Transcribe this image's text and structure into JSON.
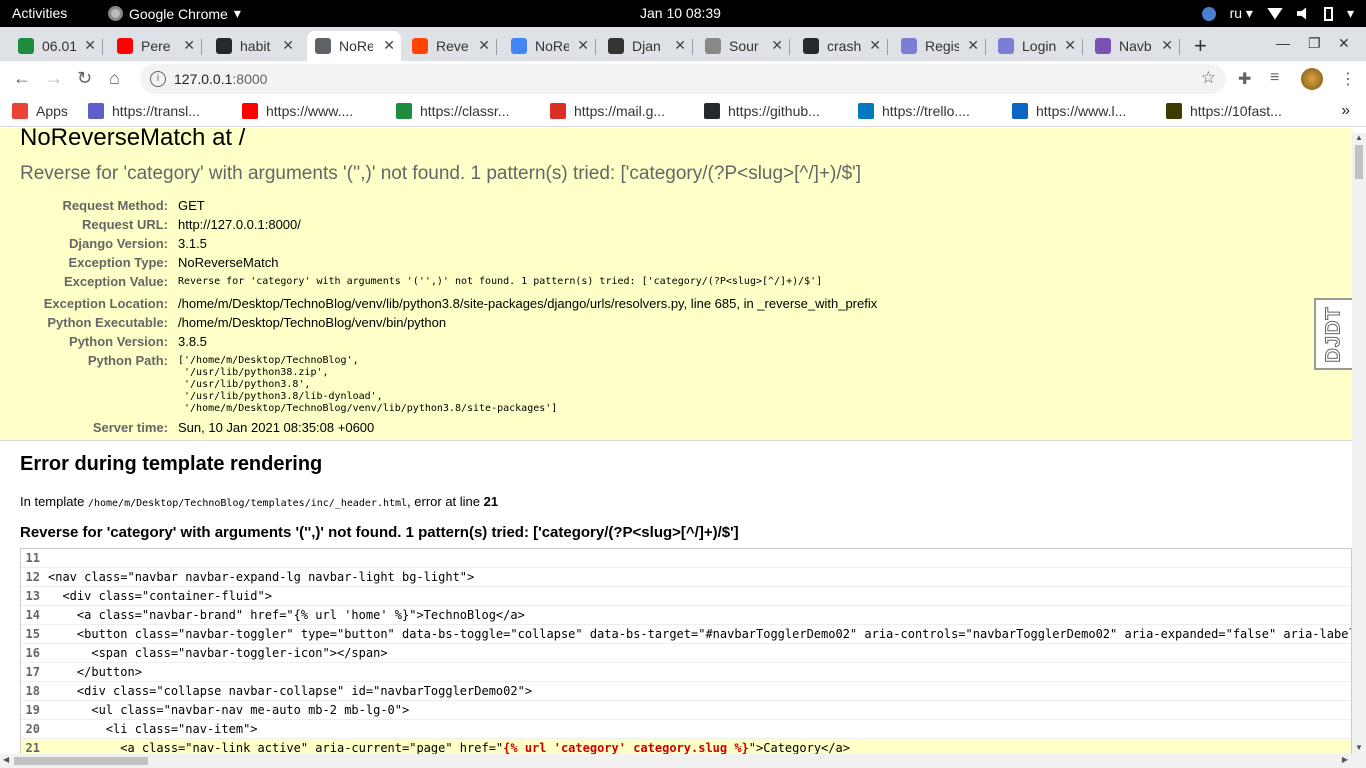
{
  "os": {
    "activities": "Activities",
    "app_name": "Google Chrome",
    "clock": "Jan 10  08:39",
    "language": "ru"
  },
  "tabs": [
    {
      "title": "06.01",
      "color": "#1e8e3e"
    },
    {
      "title": "Pere",
      "color": "#ff0000"
    },
    {
      "title": "habit",
      "color": "#24292e"
    },
    {
      "title": "NoRe",
      "color": "#5f6368"
    },
    {
      "title": "Reve",
      "color": "#ff4500"
    },
    {
      "title": "NoRe",
      "color": "#4285f4"
    },
    {
      "title": "Djan",
      "color": "#333333"
    },
    {
      "title": "Sour",
      "color": "#888888"
    },
    {
      "title": "crash",
      "color": "#24292e"
    },
    {
      "title": "Regis",
      "color": "#7b7fd4"
    },
    {
      "title": "Login",
      "color": "#7b7fd4"
    },
    {
      "title": "Navb",
      "color": "#7952b3"
    }
  ],
  "address": {
    "host": "127.0.0.1",
    "port": ":8000"
  },
  "bookmarks": [
    {
      "label": "Apps",
      "color": "#ea4335"
    },
    {
      "label": "https://transl...",
      "color": "#5b5fc7"
    },
    {
      "label": "https://www....",
      "color": "#ff0000"
    },
    {
      "label": "https://classr...",
      "color": "#1e8e3e"
    },
    {
      "label": "https://mail.g...",
      "color": "#d93025"
    },
    {
      "label": "https://github...",
      "color": "#24292e"
    },
    {
      "label": "https://trello....",
      "color": "#0079bf"
    },
    {
      "label": "https://www.l...",
      "color": "#0a66c2"
    },
    {
      "label": "https://10fast...",
      "color": "#3c3c00"
    }
  ],
  "error": {
    "title": "NoReverseMatch at /",
    "message": "Reverse for 'category' with arguments '('',)' not found. 1 pattern(s) tried: ['category/(?P<slug>[^/]+)/$']",
    "meta": [
      {
        "key": "Request Method:",
        "value": "GET"
      },
      {
        "key": "Request URL:",
        "value": "http://127.0.0.1:8000/"
      },
      {
        "key": "Django Version:",
        "value": "3.1.5"
      },
      {
        "key": "Exception Type:",
        "value": "NoReverseMatch"
      },
      {
        "key": "Exception Value:",
        "value": "Reverse for 'category' with arguments '('',)' not found. 1 pattern(s) tried: ['category/(?P<slug>[^/]+)/$']",
        "mono": true
      },
      {
        "key": "Exception Location:",
        "value": "/home/m/Desktop/TechnoBlog/venv/lib/python3.8/site-packages/django/urls/resolvers.py, line 685, in _reverse_with_prefix"
      },
      {
        "key": "Python Executable:",
        "value": "/home/m/Desktop/TechnoBlog/venv/bin/python"
      },
      {
        "key": "Python Version:",
        "value": "3.8.5"
      },
      {
        "key": "Python Path:",
        "value": "['/home/m/Desktop/TechnoBlog',\n '/usr/lib/python38.zip',\n '/usr/lib/python3.8',\n '/usr/lib/python3.8/lib-dynload',\n '/home/m/Desktop/TechnoBlog/venv/lib/python3.8/site-packages']",
        "mono": true
      },
      {
        "key": "Server time:",
        "value": "Sun, 10 Jan 2021 08:35:08 +0600"
      }
    ],
    "djdt": "DJDT"
  },
  "template": {
    "heading": "Error during template rendering",
    "in_template": "In template",
    "path": "/home/m/Desktop/TechnoBlog/templates/inc/_header.html",
    "error_at": ", error at line",
    "line": "21",
    "message": "Reverse for 'category' with arguments '('',)' not found. 1 pattern(s) tried: ['category/(?P<slug>[^/]+)/$']",
    "source": [
      {
        "n": "11",
        "code": ""
      },
      {
        "n": "12",
        "code": "<nav class=\"navbar navbar-expand-lg navbar-light bg-light\">"
      },
      {
        "n": "13",
        "code": "  <div class=\"container-fluid\">"
      },
      {
        "n": "14",
        "code": "    <a class=\"navbar-brand\" href=\"{% url 'home' %}\">TechnoBlog</a>"
      },
      {
        "n": "15",
        "code": "    <button class=\"navbar-toggler\" type=\"button\" data-bs-toggle=\"collapse\" data-bs-target=\"#navbarTogglerDemo02\" aria-controls=\"navbarTogglerDemo02\" aria-expanded=\"false\" aria-label"
      },
      {
        "n": "16",
        "code": "      <span class=\"navbar-toggler-icon\"></span>"
      },
      {
        "n": "17",
        "code": "    </button>"
      },
      {
        "n": "18",
        "code": "    <div class=\"collapse navbar-collapse\" id=\"navbarTogglerDemo02\">"
      },
      {
        "n": "19",
        "code": "      <ul class=\"navbar-nav me-auto mb-2 mb-lg-0\">"
      },
      {
        "n": "20",
        "code": "        <li class=\"nav-item\">"
      },
      {
        "n": "21",
        "pre": "          <a class=\"nav-link active\" aria-current=\"page\" href=\"",
        "hl": "{% url 'category' category.slug %}",
        "post": "\">Category</a>",
        "error": true
      }
    ]
  }
}
